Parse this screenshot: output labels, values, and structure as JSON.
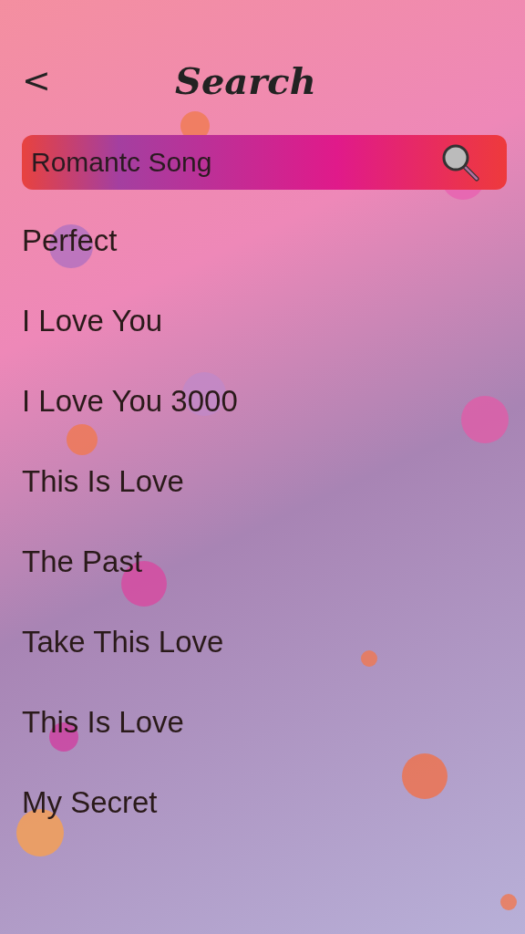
{
  "header": {
    "back": "<",
    "title": "Search"
  },
  "search": {
    "value": "Romantc Song"
  },
  "songs": [
    {
      "title": "Perfect"
    },
    {
      "title": "I Love You"
    },
    {
      "title": "I Love You 3000"
    },
    {
      "title": "This Is Love"
    },
    {
      "title": "The Past"
    },
    {
      "title": "Take This Love"
    },
    {
      "title": "This Is Love"
    },
    {
      "title": "My Secret"
    }
  ]
}
